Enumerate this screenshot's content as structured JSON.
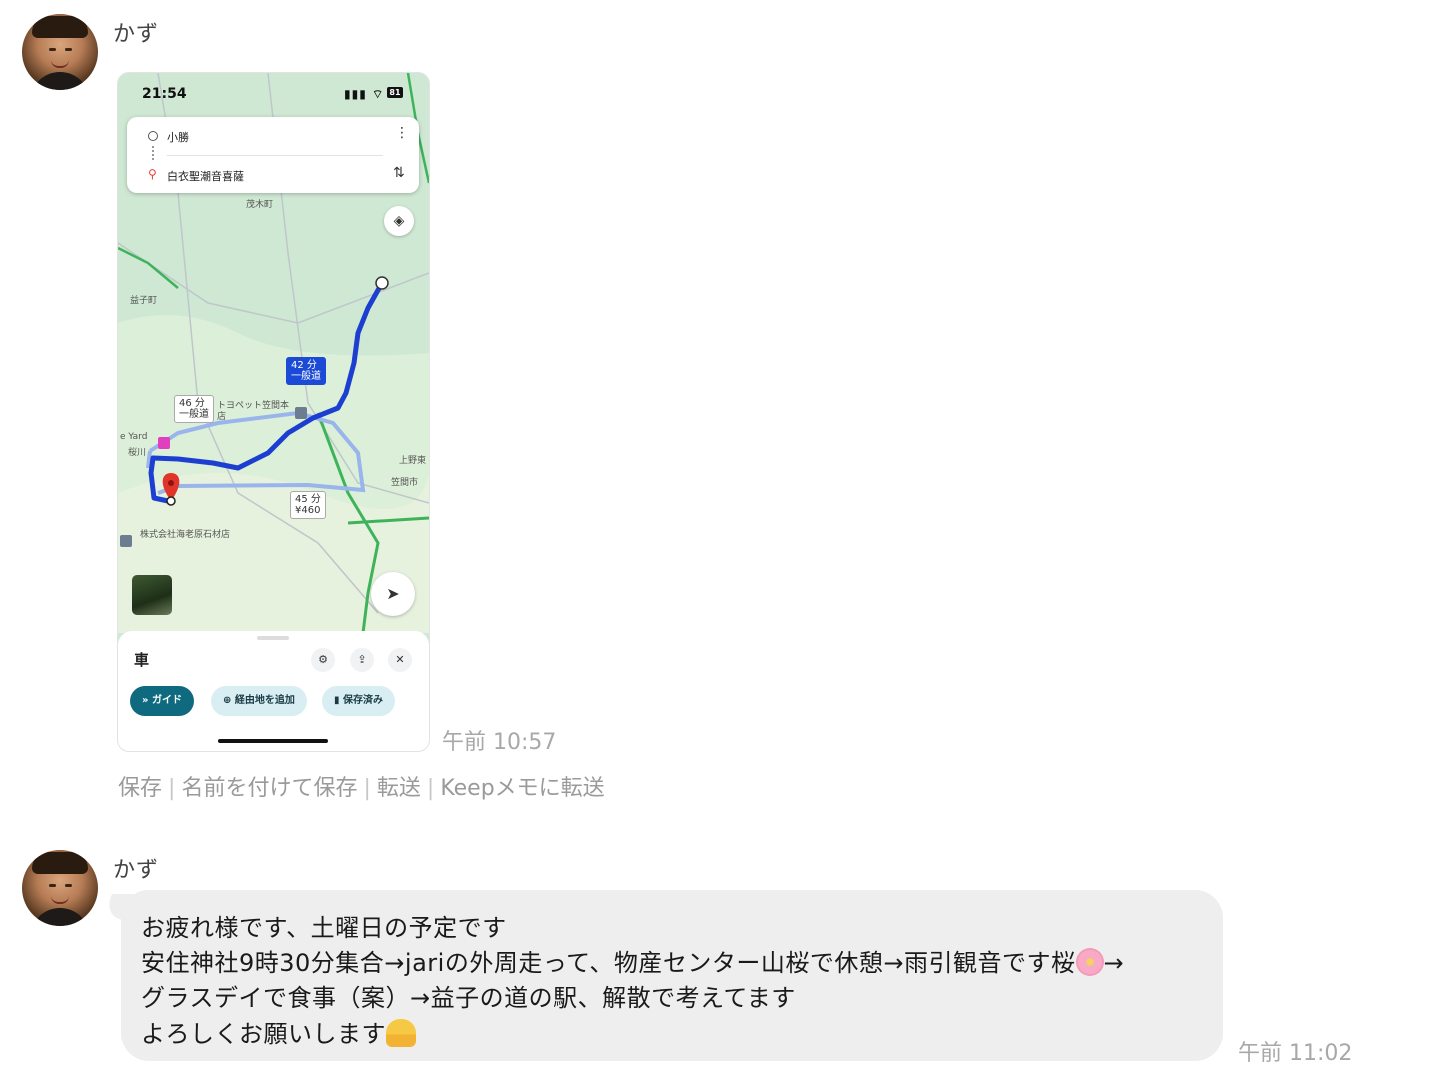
{
  "messages": [
    {
      "sender": "かず",
      "time": "午前 10:57",
      "screenshot": {
        "status_time": "21:54",
        "battery": "81",
        "origin": "小勝",
        "destination": "白衣聖潮音喜薩",
        "map_labels": [
          "茂木町",
          "益子町",
          "トヨペット笠間本店",
          "e Yard",
          "桜川",
          "株式会社海老原石材店",
          "笠間市",
          "上野東"
        ],
        "routes": [
          {
            "time": "42 分",
            "type": "一般道",
            "selected": true
          },
          {
            "time": "46 分",
            "type": "一般道",
            "selected": false
          },
          {
            "time": "45 分",
            "type": "¥460",
            "selected": false
          }
        ],
        "mode": "車",
        "buttons": [
          "ガイド",
          "経由地を追加",
          "保存済み"
        ],
        "icons": [
          "navigation-arrow-icon",
          "layers-icon",
          "tune-icon",
          "share-icon",
          "close-icon",
          "bookmark-icon"
        ]
      },
      "actions": [
        "保存",
        "名前を付けて保存",
        "転送",
        "Keepメモに転送"
      ]
    },
    {
      "sender": "かず",
      "time": "午前 11:02",
      "lines": [
        "お疲れ様です、土曜日の予定です",
        "安住神社9時30分集合→jariの外周走って、物産センター山桜で休憩→雨引観音です桜",
        "→",
        "グラスデイで食事（案）→益子の道の駅、解散で考えてます",
        "よろしくお願いします"
      ]
    }
  ]
}
